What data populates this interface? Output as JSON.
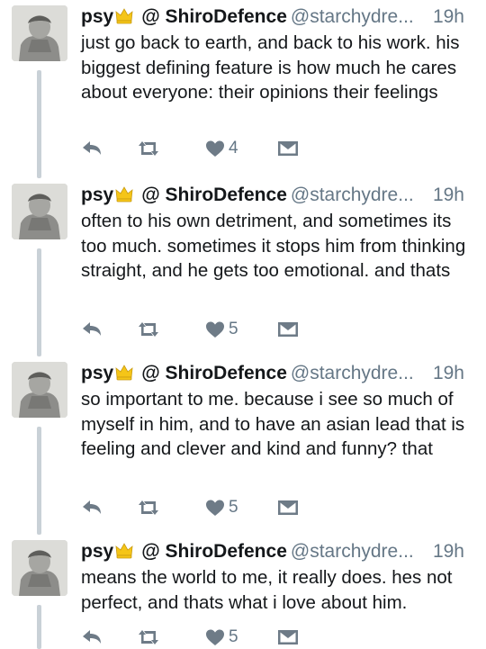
{
  "icons": {
    "avatar": "avatar-image",
    "badge": "crown-emoji-icon",
    "reply": "reply-icon",
    "retweet": "retweet-icon",
    "like": "heart-icon",
    "dm": "direct-message-icon"
  },
  "colors": {
    "text": "#14171a",
    "muted": "#657786",
    "thread_line": "#c9d1d7",
    "icon": "#6e7b87",
    "crown": "#f5c518"
  },
  "tweets": [
    {
      "name": "psy",
      "display_name": "@ ShiroDefence",
      "handle": "@starchydre...",
      "time": "19h",
      "text": "just go back to earth, and back to his work. his biggest defining feature is how much he cares about everyone: their opinions their feelings",
      "likes": "4"
    },
    {
      "name": "psy",
      "display_name": "@ ShiroDefence",
      "handle": "@starchydre...",
      "time": "19h",
      "text": "often to his own detriment, and sometimes its too much. sometimes it stops him from thinking straight, and he gets too emotional. and thats",
      "likes": "5"
    },
    {
      "name": "psy",
      "display_name": "@ ShiroDefence",
      "handle": "@starchydre...",
      "time": "19h",
      "text": "so important to me. because i see so much of myself in him, and to have an asian lead that is feeling and clever and kind and funny? that",
      "likes": "5"
    },
    {
      "name": "psy",
      "display_name": "@ ShiroDefence",
      "handle": "@starchydre...",
      "time": "19h",
      "text": "means the world to me, it really does. hes not perfect, and thats what i love about him.",
      "likes": "5"
    }
  ]
}
